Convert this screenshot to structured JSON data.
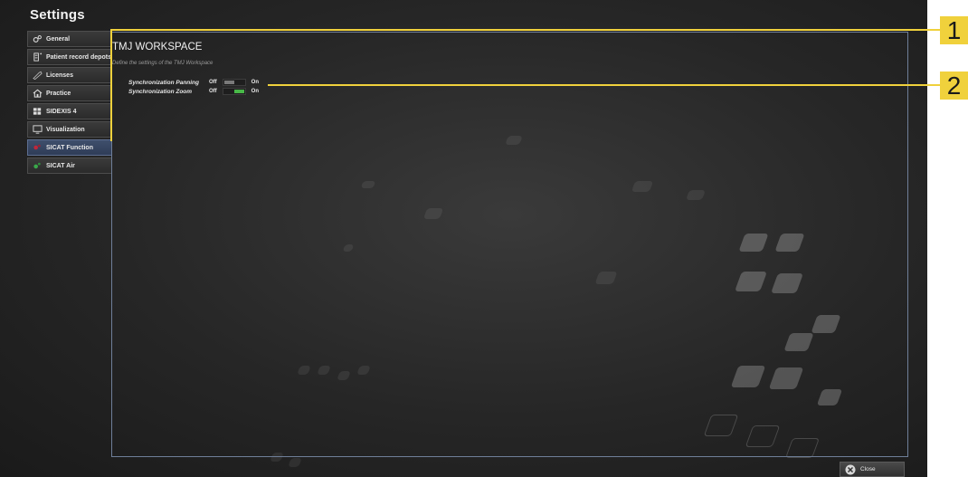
{
  "window": {
    "title": "Settings"
  },
  "sidebar": {
    "items": [
      {
        "label": "General",
        "icon": "gears-icon"
      },
      {
        "label": "Patient record depots",
        "icon": "server-icon"
      },
      {
        "label": "Licenses",
        "icon": "key-icon"
      },
      {
        "label": "Practice",
        "icon": "house-icon"
      },
      {
        "label": "SIDEXIS 4",
        "icon": "sidexis-icon"
      },
      {
        "label": "Visualization",
        "icon": "monitor-icon"
      },
      {
        "label": "SICAT Function",
        "icon": "sicat-function-icon",
        "active": true
      },
      {
        "label": "SICAT Air",
        "icon": "sicat-air-icon"
      }
    ]
  },
  "panel": {
    "heading": "TMJ WORKSPACE",
    "subtitle": "Define the settings of the TMJ Workspace",
    "settings": [
      {
        "label": "Synchronization Panning",
        "off_label": "Off",
        "on_label": "On",
        "state": "off"
      },
      {
        "label": "Synchronization Zoom",
        "off_label": "Off",
        "on_label": "On",
        "state": "on"
      }
    ]
  },
  "footer": {
    "close_label": "Close"
  },
  "callouts": [
    {
      "number": "1"
    },
    {
      "number": "2"
    }
  ],
  "colors": {
    "accent_callout": "#f0d13c",
    "active_nav": "#3f4f6c",
    "toggle_on": "#48b848"
  }
}
